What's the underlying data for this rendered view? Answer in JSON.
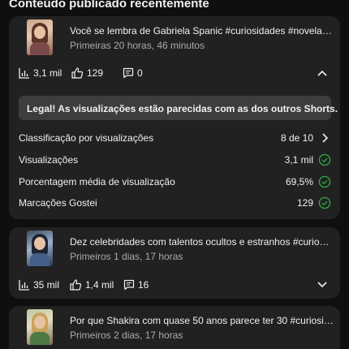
{
  "section": {
    "title": "Conteúdo publicado recentemente"
  },
  "videos": [
    {
      "title": "Você se lembra de Gabriela Spanic #curiosidades #novela #f...",
      "time": "Primeiras 20 horas, 46 minutos",
      "views": "3,1 mil",
      "likes": "129",
      "comments": "0",
      "expanded": true
    },
    {
      "title": "Dez celebridades com talentos ocultos e estranhos #curiosida...",
      "time": "Primeiros 1 dias, 17 horas",
      "views": "35 mil",
      "likes": "1,4 mil",
      "comments": "16",
      "expanded": false
    },
    {
      "title": "Por que Shakira com quase 50 anos parece ter 30 #curiosida...",
      "time": "Primeiros 2 dias, 17 horas"
    }
  ],
  "details": {
    "banner": "Legal! As visualizações estão parecidas com as dos outros Shorts.",
    "metrics": [
      {
        "label": "Classificação por visualizações",
        "value": "8 de 10",
        "icon": "chevron-right-icon"
      },
      {
        "label": "Visualizações",
        "value": "3,1 mil",
        "icon": "check-circle-icon"
      },
      {
        "label": "Porcentagem média de visualização",
        "value": "69,5%",
        "icon": "check-circle-icon"
      },
      {
        "label": "Marcações Gostei",
        "value": "129",
        "icon": "check-circle-icon"
      }
    ]
  },
  "colors": {
    "background": "#0f0f0f",
    "card": "#212121",
    "banner": "#3d3d3d",
    "success": "#2ba640",
    "secondary_text": "#aaaaaa"
  }
}
